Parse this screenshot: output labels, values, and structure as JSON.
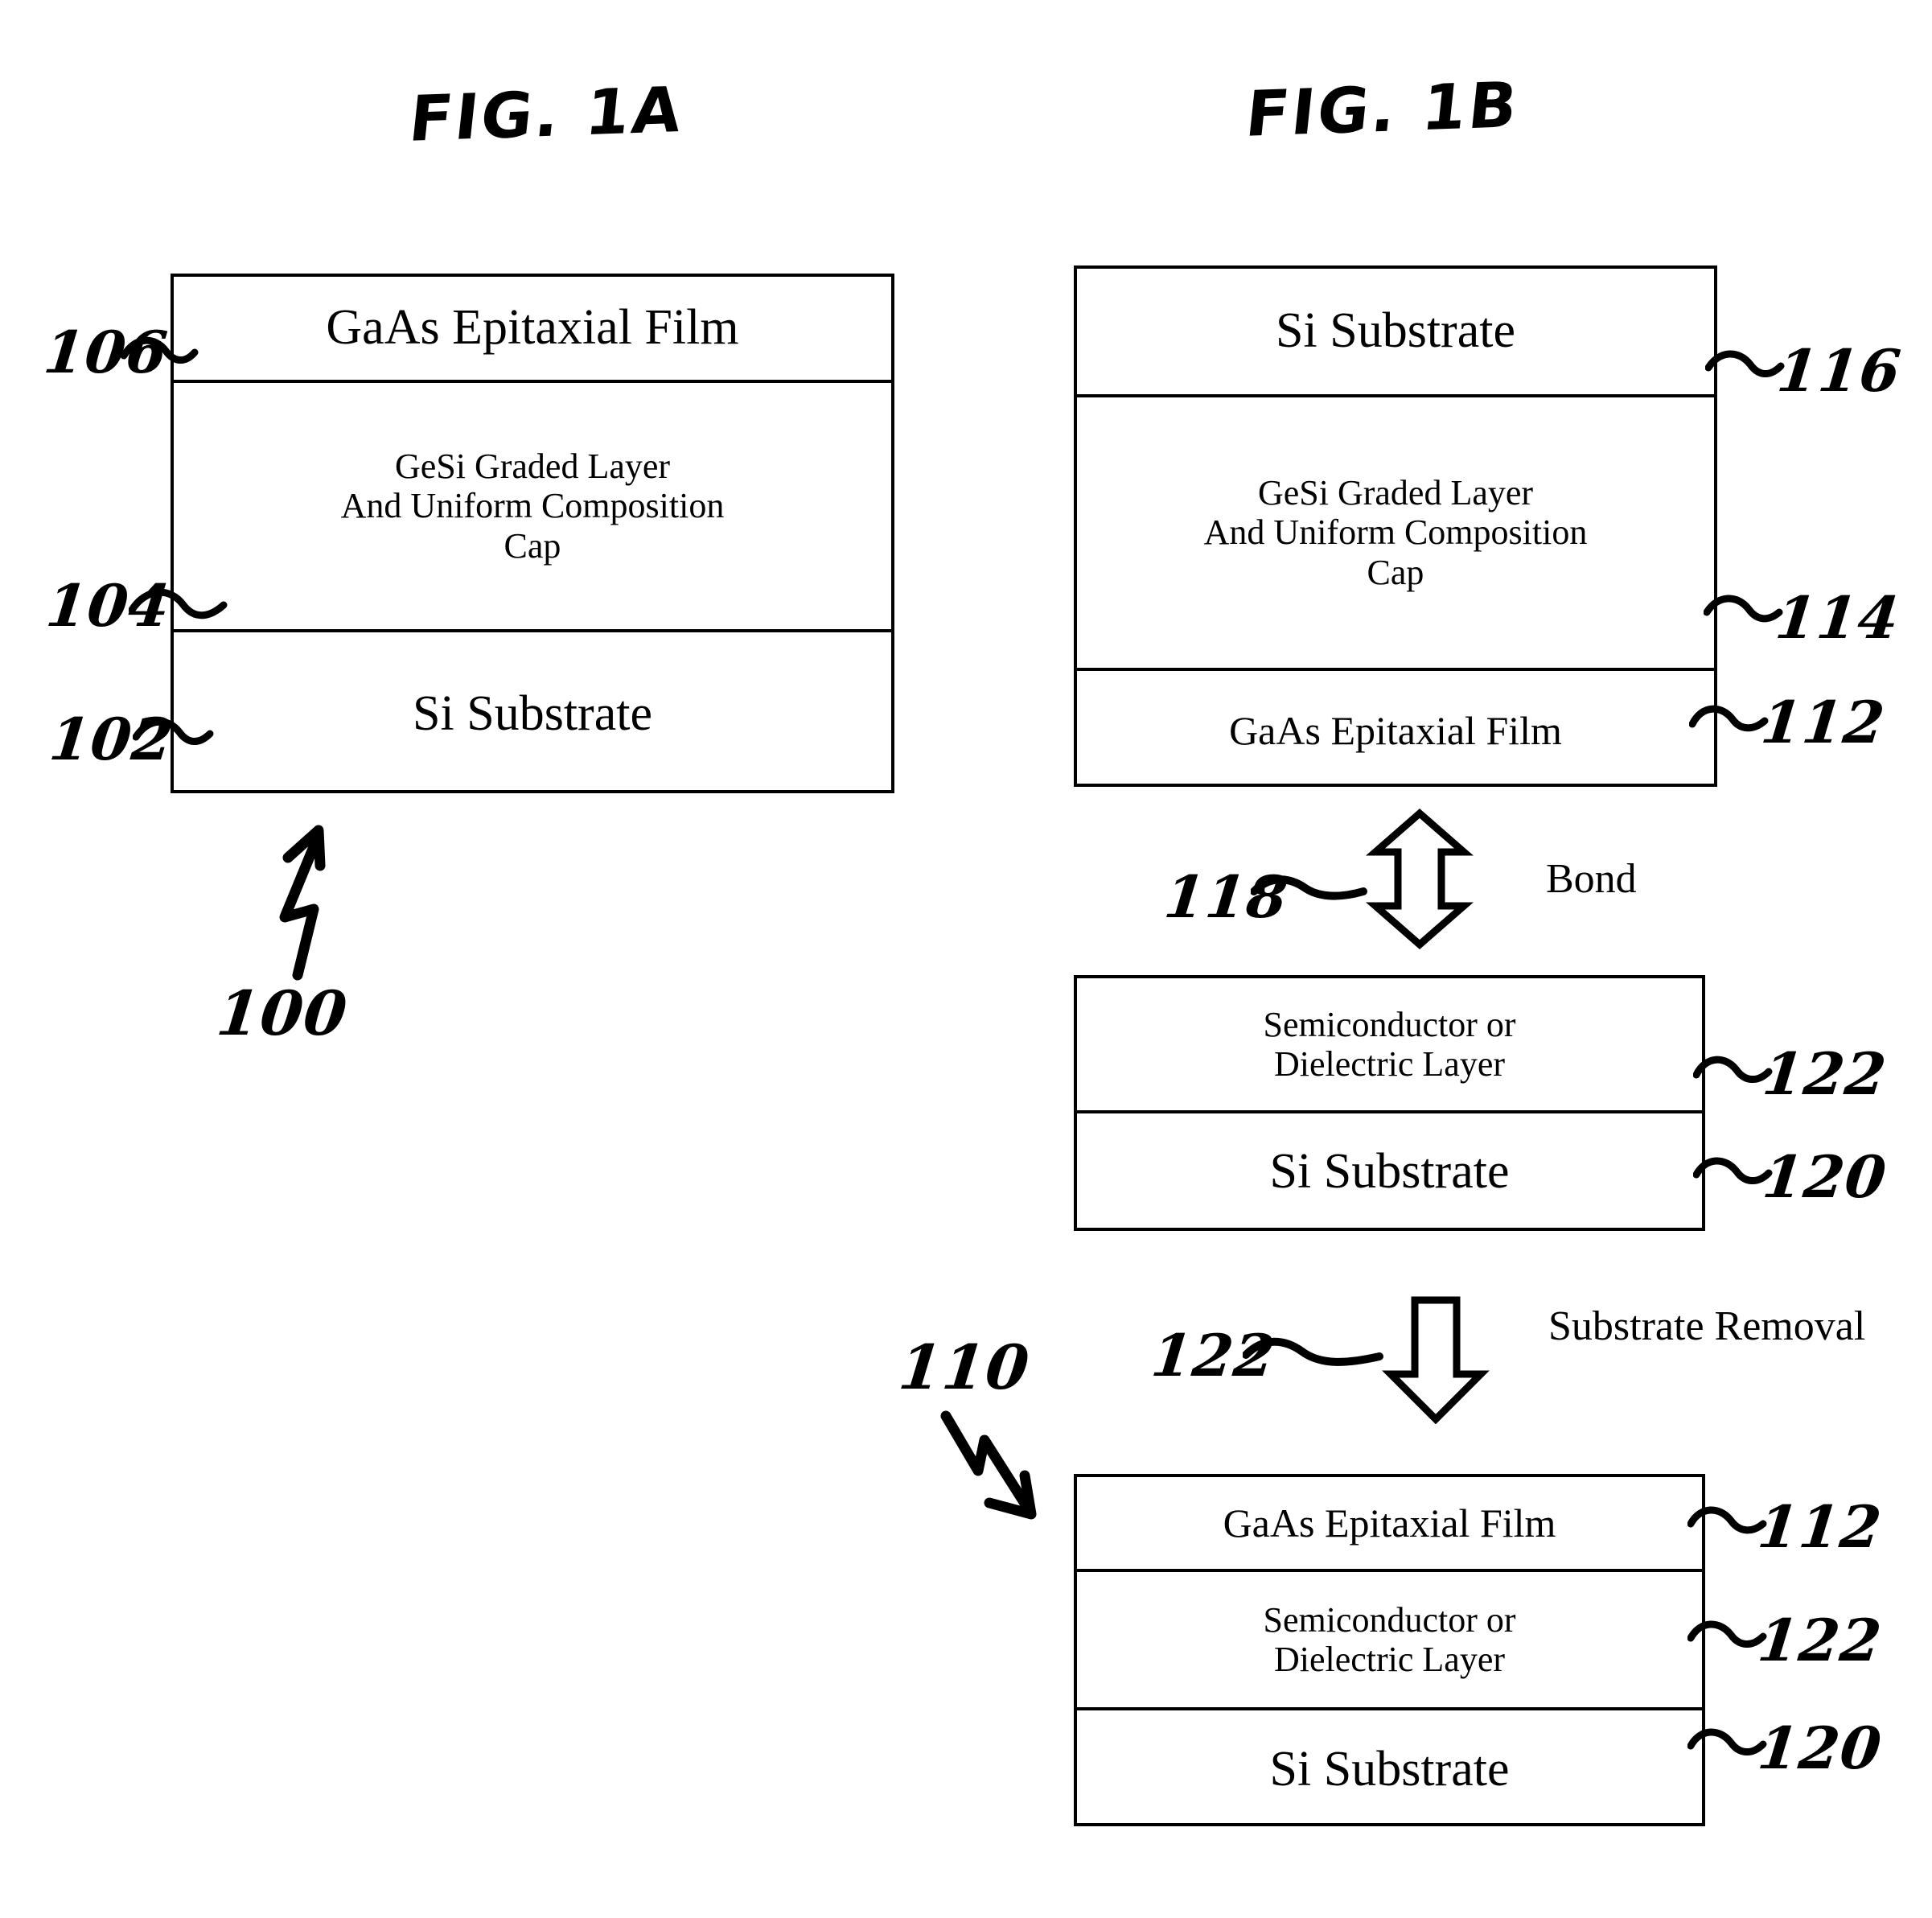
{
  "figures": [
    {
      "id": "fig-1a",
      "title": "FIG. 1A",
      "assembly_label": "100",
      "stack": {
        "layers": [
          {
            "ref": "106",
            "lines": [
              "GaAs Epitaxial Film"
            ]
          },
          {
            "ref": "104",
            "lines": [
              "GeSi Graded Layer",
              "And Uniform Composition",
              "Cap"
            ]
          },
          {
            "ref": "102",
            "lines": [
              "Si Substrate"
            ]
          }
        ]
      }
    },
    {
      "id": "fig-1b",
      "title": "FIG. 1B",
      "assembly_label": "110",
      "stacks": [
        {
          "id": "stack-top",
          "layers": [
            {
              "ref": "116",
              "lines": [
                "Si Substrate"
              ]
            },
            {
              "ref": "114",
              "lines": [
                "GeSi Graded Layer",
                "And Uniform Composition",
                "Cap"
              ]
            },
            {
              "ref": "112",
              "lines": [
                "GaAs Epitaxial Film"
              ]
            }
          ]
        },
        {
          "id": "stack-middle",
          "layers": [
            {
              "ref": "122",
              "lines": [
                "Semiconductor or",
                "Dielectric Layer"
              ]
            },
            {
              "ref": "120",
              "lines": [
                "Si Substrate"
              ]
            }
          ]
        },
        {
          "id": "stack-bottom",
          "layers": [
            {
              "ref": "112",
              "lines": [
                "GaAs Epitaxial Film"
              ]
            },
            {
              "ref": "122",
              "lines": [
                "Semiconductor or",
                "Dielectric Layer"
              ]
            },
            {
              "ref": "120",
              "lines": [
                "Si Substrate"
              ]
            }
          ]
        }
      ],
      "process_steps": [
        {
          "id": "bond",
          "ref": "118",
          "lines": [
            "Bond"
          ],
          "arrow": "double-headed-vertical-hollow-arrow"
        },
        {
          "id": "substrate-removal",
          "ref": "122",
          "lines": [
            "Substrate",
            "Removal"
          ],
          "arrow": "down-hollow-arrow"
        }
      ]
    }
  ],
  "labels": {
    "ref_106": "106",
    "ref_104": "104",
    "ref_102": "102",
    "ref_100": "100",
    "ref_116": "116",
    "ref_114": "114",
    "ref_112_top": "112",
    "ref_118": "118",
    "ref_122_mid": "122",
    "ref_120_mid": "120",
    "ref_122_arrow": "122",
    "ref_110": "110",
    "ref_112_bot": "112",
    "ref_122_bot": "122",
    "ref_120_bot": "120"
  },
  "text": {
    "fig1a_title": "FIG. 1A",
    "fig1b_title": "FIG. 1B",
    "gaas": "GaAs Epitaxial Film",
    "gesi_l1": "GeSi Graded Layer",
    "gesi_l2": "And Uniform Composition",
    "gesi_l3": "Cap",
    "si_substrate": "Si Substrate",
    "semi_l1": "Semiconductor or",
    "semi_l2": "Dielectric Layer",
    "bond": "Bond",
    "removal_l1": "Substrate",
    "removal_l2": "Removal"
  },
  "colors": {
    "ink": "#000000",
    "paper": "#ffffff"
  }
}
